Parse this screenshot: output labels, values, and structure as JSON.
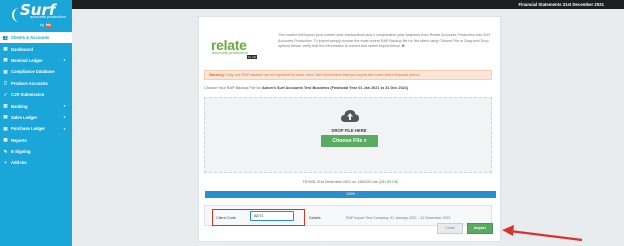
{
  "brand": {
    "name": "Surf",
    "sub": "accounts production",
    "by": "by",
    "maker": "Iris"
  },
  "topbar": {
    "title": "Financial Statements 31st December 2021"
  },
  "sidebar": {
    "items": [
      {
        "label": "Clients & Accounts",
        "icon": "users-icon",
        "active": true
      },
      {
        "label": "Dashboard",
        "icon": "dashboard-icon"
      },
      {
        "label": "Nominal Ledger",
        "icon": "ledger-icon",
        "has_arrow": true
      },
      {
        "label": "Compliance Database",
        "icon": "database-icon"
      },
      {
        "label": "Produce Accounts",
        "icon": "document-icon"
      },
      {
        "label": "CJR Submission",
        "icon": "submission-icon"
      },
      {
        "label": "Banking",
        "icon": "bank-icon",
        "has_arrow": true
      },
      {
        "label": "Sales Ledger",
        "icon": "sales-icon",
        "has_arrow": true
      },
      {
        "label": "Purchase Ledger",
        "icon": "cart-icon",
        "has_arrow": true
      },
      {
        "label": "Reports",
        "icon": "report-icon"
      },
      {
        "label": "E-Signing",
        "icon": "signature-icon"
      },
      {
        "label": "Add-Ins",
        "icon": "plus-icon"
      }
    ]
  },
  "relate": {
    "word": "relate",
    "sub": "accounts production",
    "by": "by Iris"
  },
  "intro": {
    "text": "This routine will import your current year transactions plus it comparative year balances from Relate Accounts Production into Surf Accounts Production. To import simply choose the most recent RAP Backup file for the client using Choose File or Drag and Drop options below, verify that the information is correct and select Import below. ❶"
  },
  "warning": {
    "label": "Warning:",
    "text": "Only one RAP dataset can be imported for each client. We recommend that you import the most recent financial period."
  },
  "choose_line": {
    "prefix": "Choose Your RAP Backup File for",
    "client": "Aaron's Surf Accounts Test Business (Financial Year 01 Jan 2021 to 31 Dec 2021)"
  },
  "drop": {
    "text": "DROP FILE HERE",
    "button": "Choose File"
  },
  "file": {
    "name": "TES001 31st December 2021 on 1482022.rds",
    "size": "(281.89 KB)"
  },
  "progress": {
    "value": 100,
    "label": "100%"
  },
  "client": {
    "label": "Client Code",
    "value": "AET1",
    "details_label": "Details",
    "details_value": "RAP Import Test Company, 01 January 2021 - 31 December 2021"
  },
  "buttons": {
    "close": "Close",
    "import": "Import"
  },
  "colors": {
    "sidebar": "#1aa6d8",
    "accent_green": "#5aaa62",
    "warning_bg": "#fbe6d7",
    "highlight": "#d9342b"
  }
}
